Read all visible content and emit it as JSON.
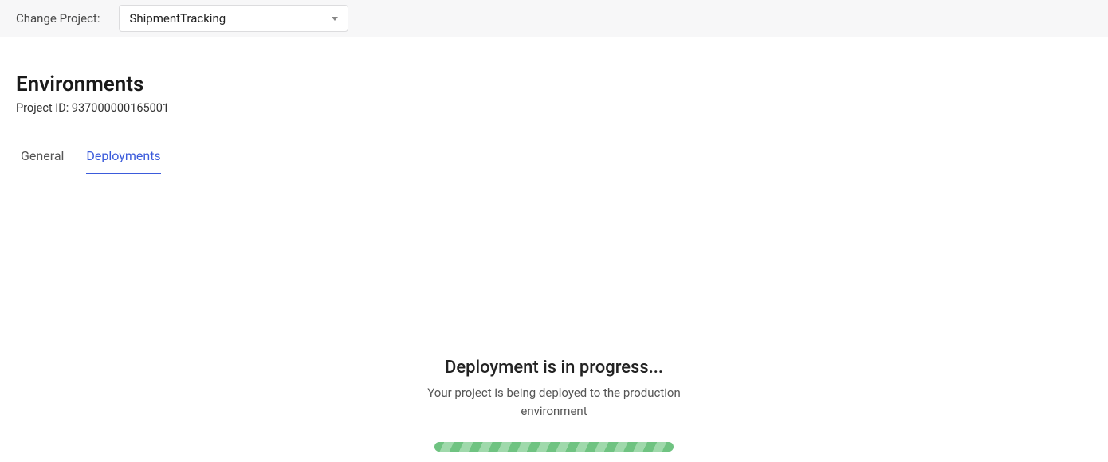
{
  "topbar": {
    "change_project_label": "Change Project:",
    "selected_project": "ShipmentTracking"
  },
  "header": {
    "title": "Environments",
    "project_id_label": "Project ID: 937000000165001"
  },
  "tabs": {
    "general": "General",
    "deployments": "Deployments"
  },
  "status": {
    "heading": "Deployment is in progress...",
    "sub": "Your project is being deployed to the production environment"
  }
}
